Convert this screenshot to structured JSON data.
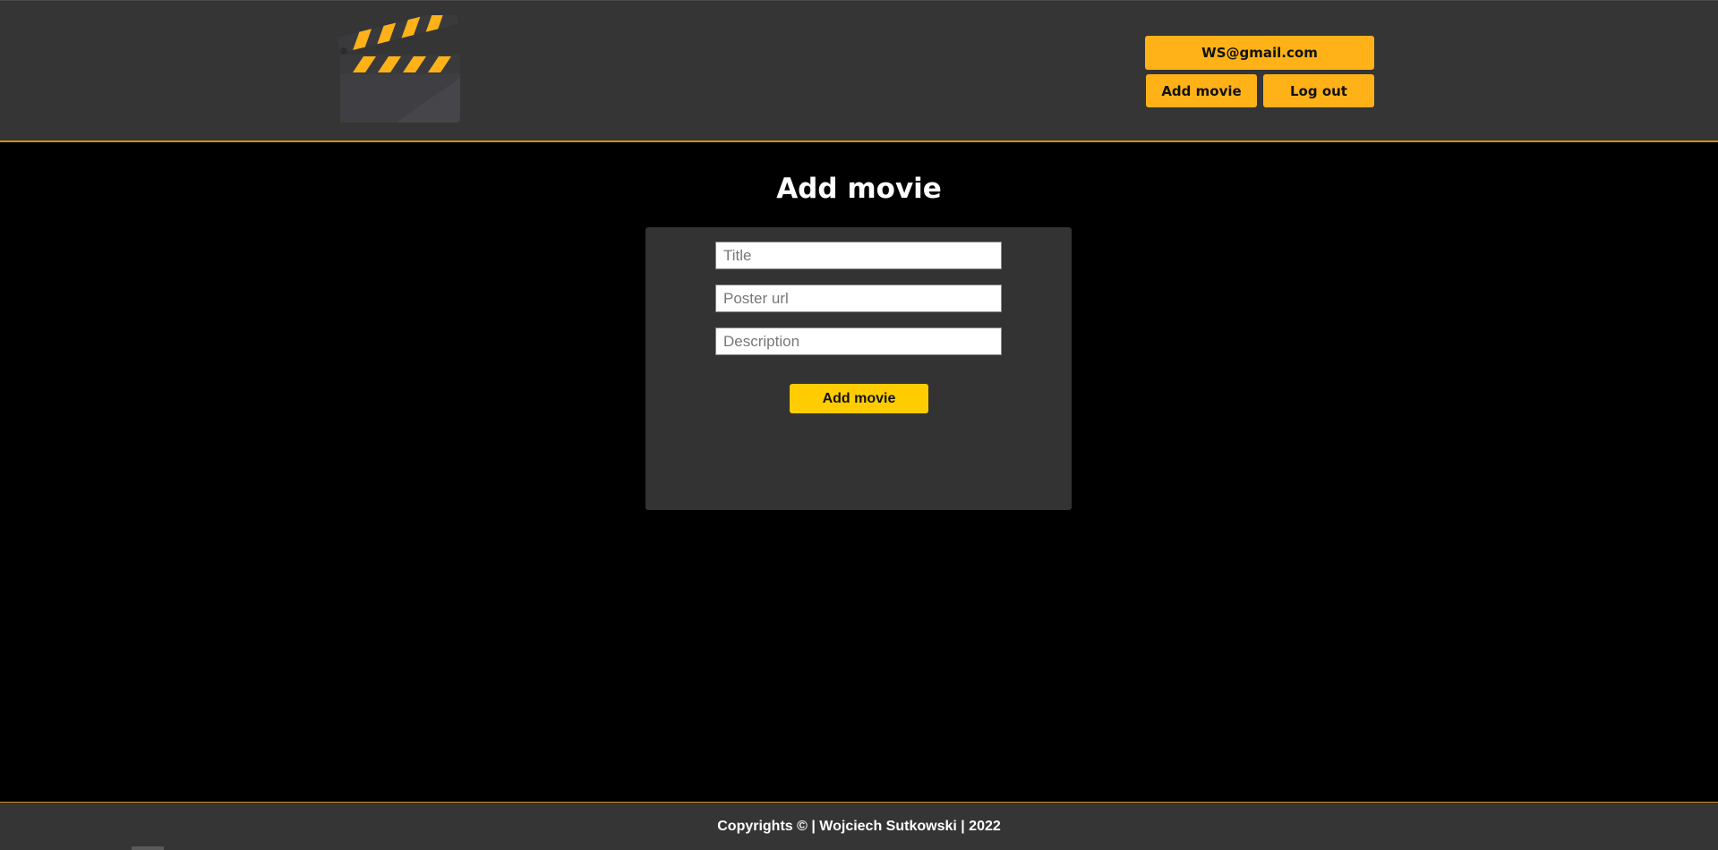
{
  "header": {
    "logo_icon": "clapperboard-icon",
    "user_email": "WS@gmail.com",
    "add_movie_label": "Add movie",
    "logout_label": "Log out",
    "accent_color": "#ffb218"
  },
  "main": {
    "page_title": "Add movie",
    "form": {
      "title_placeholder": "Title",
      "title_value": "",
      "poster_placeholder": "Poster url",
      "poster_value": "",
      "description_placeholder": "Description",
      "description_value": "",
      "submit_label": "Add movie"
    }
  },
  "footer": {
    "copyright": "Copyrights © | Wojciech Sutkowski | 2022"
  }
}
